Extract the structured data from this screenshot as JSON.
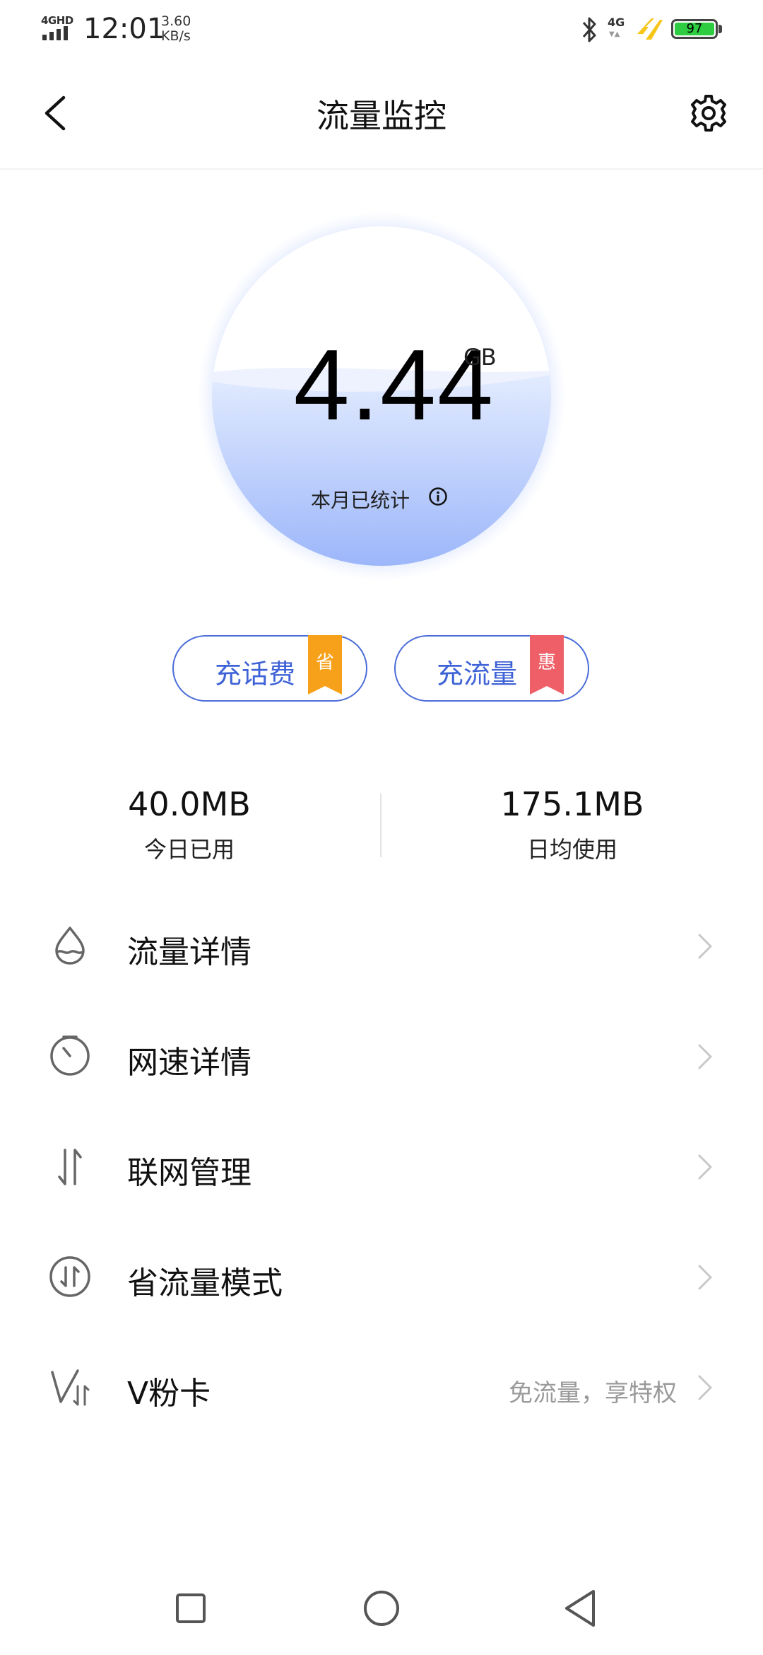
{
  "status_bar": {
    "signal_label": "4GHD",
    "time": "12:01",
    "speed_value": "3.60",
    "speed_unit": "KB/s",
    "network_type": "4G",
    "battery_level": "97",
    "battery_color": "#2ecc40",
    "icons": [
      "signal-icon",
      "bluetooth-icon",
      "charging-bolt-icon",
      "battery-icon"
    ]
  },
  "header": {
    "title": "流量监控",
    "back_icon": "back-arrow-icon",
    "settings_icon": "gear-icon"
  },
  "usage": {
    "value": "4.44",
    "unit": "GB",
    "caption": "本月已统计",
    "info_icon": "info-icon",
    "fill_level": 0.55
  },
  "recharge": [
    {
      "label": "充话费",
      "badge": "省",
      "badge_color": "#f7a11a"
    },
    {
      "label": "充流量",
      "badge": "惠",
      "badge_color": "#ee5f67"
    }
  ],
  "stats": {
    "today": {
      "value": "40.0MB",
      "label": "今日已用"
    },
    "daily_average": {
      "value": "175.1MB",
      "label": "日均使用"
    }
  },
  "menu": [
    {
      "label": "流量详情",
      "icon": "water-drop-icon",
      "subtitle": ""
    },
    {
      "label": "网速详情",
      "icon": "speed-gauge-icon",
      "subtitle": ""
    },
    {
      "label": "联网管理",
      "icon": "up-down-arrows-icon",
      "subtitle": ""
    },
    {
      "label": "省流量模式",
      "icon": "data-saver-icon",
      "subtitle": ""
    },
    {
      "label": "V粉卡",
      "icon": "v-card-icon",
      "subtitle": "免流量，享特权"
    }
  ],
  "nav_bar": {
    "icons": [
      "recent-apps-icon",
      "home-icon",
      "back-nav-icon"
    ]
  },
  "colors": {
    "accent": "#3f63d6",
    "wave_top": "#dfe9fe",
    "wave_bottom": "#9db7fb"
  }
}
